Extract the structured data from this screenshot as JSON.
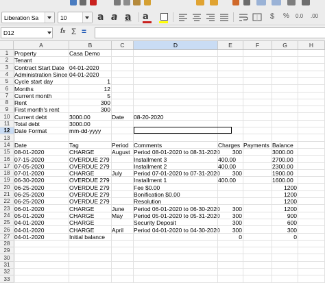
{
  "toolbar": {
    "font_name": "Liberation Sa",
    "font_size": "10",
    "icons": [
      "save-icon",
      "print-icon",
      "undo-icon",
      "redo-icon",
      "find-replace-icon",
      "spelling-icon",
      "clone-formatting-icon",
      "clear-formatting-icon",
      "bold-icon",
      "italic-icon",
      "underline-icon",
      "font-color-icon",
      "highlight-color-icon",
      "align-left-icon",
      "align-center-icon",
      "align-right-icon"
    ],
    "colors": {
      "font_color": "#c9211e",
      "highlight_color": "#ffff00"
    }
  },
  "formula_bar": {
    "name_box": "D12",
    "formula": ""
  },
  "columns": [
    "A",
    "B",
    "C",
    "D",
    "E",
    "F",
    "G",
    "H"
  ],
  "selected_cell": {
    "column": "D",
    "row": "12"
  },
  "rows": [
    {
      "n": "1",
      "cells": {
        "A": "Property",
        "B": "Casa Demo"
      }
    },
    {
      "n": "2",
      "cells": {
        "A": "Tenant"
      }
    },
    {
      "n": "3",
      "cells": {
        "A": "Contract Start Date",
        "B": "04-01-2020"
      }
    },
    {
      "n": "4",
      "cells": {
        "A": "Administration Since",
        "B": "04-01-2020"
      }
    },
    {
      "n": "5",
      "cells": {
        "A": "Cycle start day",
        "Bn": "1"
      }
    },
    {
      "n": "6",
      "cells": {
        "A": "Months",
        "Bn": "12"
      }
    },
    {
      "n": "7",
      "cells": {
        "A": "Current month",
        "Bn": "5"
      }
    },
    {
      "n": "8",
      "cells": {
        "A": "Rent",
        "Bn": "300"
      }
    },
    {
      "n": "9",
      "cells": {
        "A": "First month's rent",
        "Bn": "300"
      }
    },
    {
      "n": "10",
      "cells": {
        "A": "Current debt",
        "B": "3000.00",
        "C": "Date",
        "D": "08-20-2020"
      }
    },
    {
      "n": "11",
      "cells": {
        "A": "Total debt",
        "B": "3000.00"
      }
    },
    {
      "n": "12",
      "cells": {
        "A": "Date Format",
        "B": "mm-dd-yyyy"
      }
    },
    {
      "n": "13",
      "cells": {}
    },
    {
      "n": "14",
      "cells": {
        "A": "Date",
        "B": "Tag",
        "C": "Period",
        "D": "Comments",
        "E": "Charges",
        "F": "Payments",
        "G": "Balance"
      }
    },
    {
      "n": "15",
      "cells": {
        "A": "08-01-2020",
        "B": "CHARGE",
        "C": "August",
        "D": "Period 08-01-2020 to 08-31-2020",
        "En": "300",
        "G": "3000.00"
      }
    },
    {
      "n": "16",
      "cells": {
        "A": "07-15-2020",
        "B": "OVERDUE 279",
        "D": "Installment 3",
        "E": "400.00",
        "G": "2700.00"
      }
    },
    {
      "n": "17",
      "cells": {
        "A": "07-05-2020",
        "B": "OVERDUE 279",
        "D": "Installment 2",
        "E": "400.00",
        "G": "2300.00"
      }
    },
    {
      "n": "18",
      "cells": {
        "A": "07-01-2020",
        "B": "CHARGE",
        "C": "July",
        "D": "Period 07-01-2020 to 07-31-2020",
        "En": "300",
        "G": "1900.00"
      }
    },
    {
      "n": "19",
      "cells": {
        "A": "06-30-2020",
        "B": "OVERDUE 279",
        "D": "Installment 1",
        "E": "400.00",
        "G": "1600.00"
      }
    },
    {
      "n": "20",
      "cells": {
        "A": "06-25-2020",
        "B": "OVERDUE 279",
        "D": "Fee $0.00",
        "Gn": "1200"
      }
    },
    {
      "n": "21",
      "cells": {
        "A": "06-25-2020",
        "B": "OVERDUE 279",
        "D": "Bonification $0.00",
        "Gn": "1200"
      }
    },
    {
      "n": "22",
      "cells": {
        "A": "06-25-2020",
        "B": "OVERDUE 279",
        "D": "Resolution",
        "Gn": "1200"
      }
    },
    {
      "n": "23",
      "cells": {
        "A": "06-01-2020",
        "B": "CHARGE",
        "C": "June",
        "D": "Period 06-01-2020 to 06-30-2020",
        "En": "300",
        "Gn": "1200"
      }
    },
    {
      "n": "24",
      "cells": {
        "A": "05-01-2020",
        "B": "CHARGE",
        "C": "May",
        "D": "Period 05-01-2020 to 05-31-2020",
        "En": "300",
        "Gn": "900"
      }
    },
    {
      "n": "25",
      "cells": {
        "A": "04-01-2020",
        "B": "CHARGE",
        "D": "Security Deposit",
        "En": "300",
        "Gn": "600"
      }
    },
    {
      "n": "26",
      "cells": {
        "A": "04-01-2020",
        "B": "CHARGE",
        "C": "April",
        "D": "Period 04-01-2020 to 04-30-2020",
        "En": "300",
        "Gn": "300"
      }
    },
    {
      "n": "27",
      "cells": {
        "A": "04-01-2020",
        "B": "Initial balance",
        "En": "0",
        "Gn": "0"
      }
    },
    {
      "n": "28",
      "cells": {}
    },
    {
      "n": "29",
      "cells": {}
    },
    {
      "n": "30",
      "cells": {}
    },
    {
      "n": "31",
      "cells": {}
    },
    {
      "n": "32",
      "cells": {}
    },
    {
      "n": "33",
      "cells": {}
    }
  ]
}
